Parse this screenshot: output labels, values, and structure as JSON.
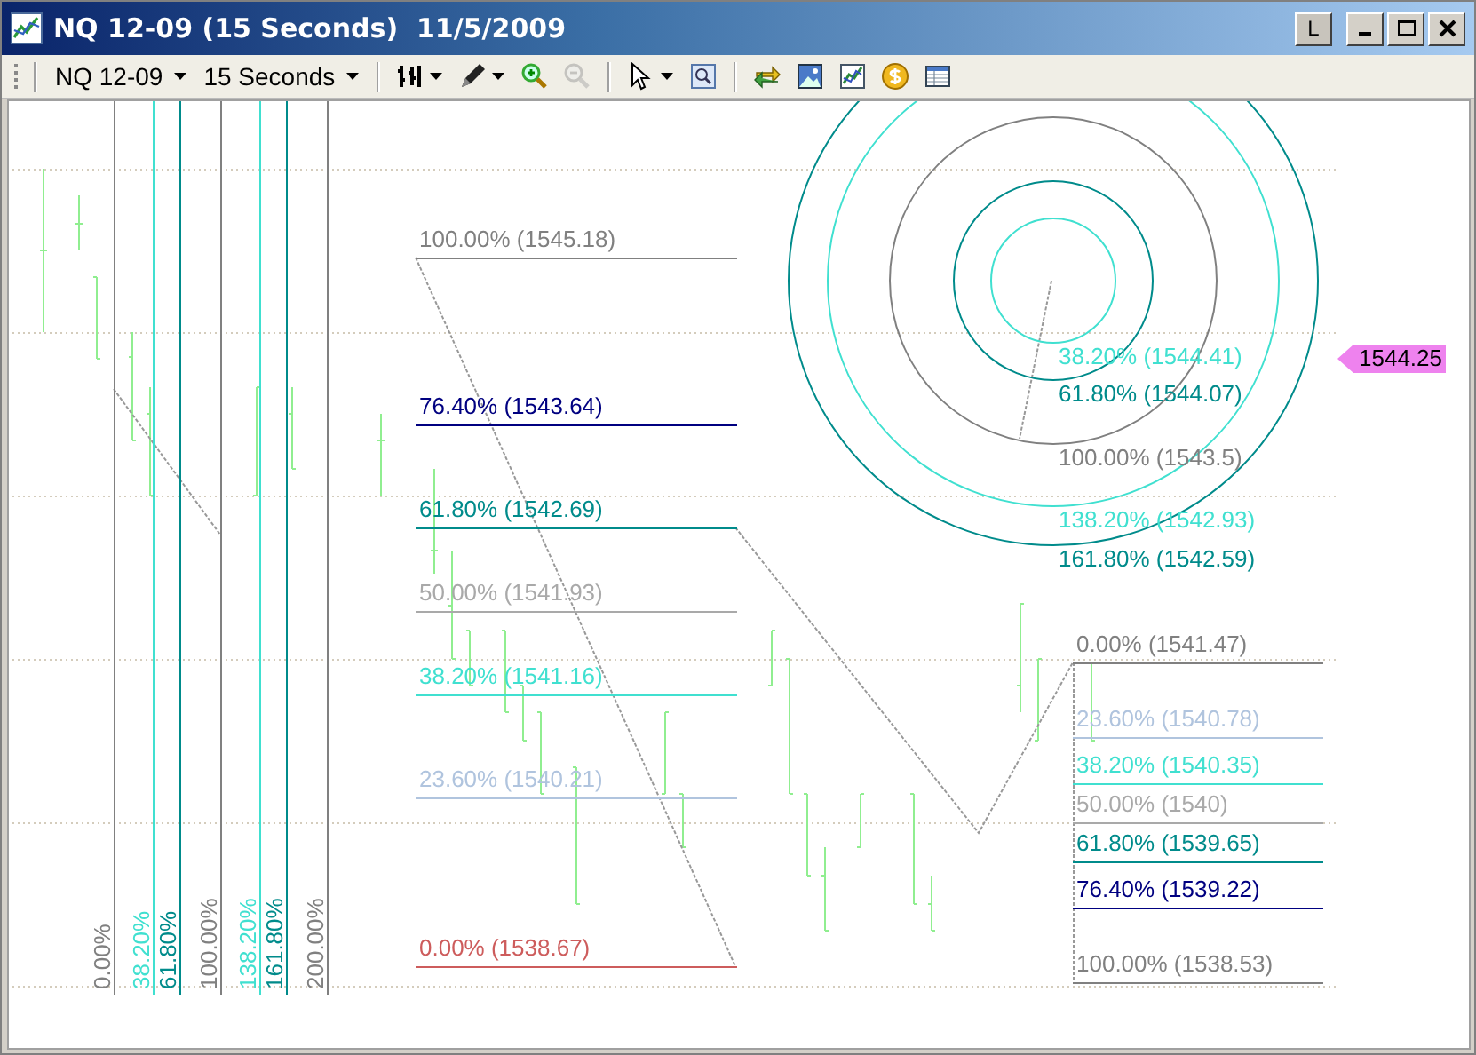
{
  "window": {
    "title": "NQ 12-09 (15 Seconds)  11/5/2009",
    "title_buttons": [
      {
        "kind": "text",
        "label": "L"
      },
      {
        "kind": "minimize"
      },
      {
        "kind": "maximize"
      },
      {
        "kind": "close"
      }
    ]
  },
  "toolbar": {
    "instrument": "NQ 12-09",
    "interval": "15 Seconds",
    "zoom_out_disabled": true
  },
  "price_marker": {
    "text": "1544.25",
    "color": "#ee82ee"
  },
  "fib_time_extensions": [
    {
      "label": "0.00%",
      "color": "#808080"
    },
    {
      "label": "38.20%",
      "color": "#40e0d0"
    },
    {
      "label": "61.80%",
      "color": "#008b8b"
    },
    {
      "label": "100.00%",
      "color": "#808080"
    },
    {
      "label": "138.20%",
      "color": "#40e0d0"
    },
    {
      "label": "161.80%",
      "color": "#008b8b"
    },
    {
      "label": "200.00%",
      "color": "#808080"
    }
  ],
  "fib_retracements": [
    {
      "label": "100.00% (1545.18)",
      "color": "#808080"
    },
    {
      "label": "76.40% (1543.64)",
      "color": "#000080"
    },
    {
      "label": "61.80% (1542.69)",
      "color": "#008b8b"
    },
    {
      "label": "50.00% (1541.93)",
      "color": "#a9a9a9"
    },
    {
      "label": "38.20% (1541.16)",
      "color": "#40e0d0"
    },
    {
      "label": "23.60% (1540.21)",
      "color": "#b0c4de"
    },
    {
      "label": "0.00% (1538.67)",
      "color": "#cd5c5c"
    }
  ],
  "fib_circles": [
    {
      "label": "38.20% (1544.41)",
      "color": "#40e0d0"
    },
    {
      "label": "61.80% (1544.07)",
      "color": "#008b8b"
    },
    {
      "label": "100.00% (1543.5)",
      "color": "#808080"
    },
    {
      "label": "138.20% (1542.93)",
      "color": "#40e0d0"
    },
    {
      "label": "161.80% (1542.59)",
      "color": "#008b8b"
    }
  ],
  "fib_extensions": [
    {
      "label": "0.00% (1541.47)",
      "color": "#808080"
    },
    {
      "label": "23.60% (1540.78)",
      "color": "#b0c4de"
    },
    {
      "label": "38.20% (1540.35)",
      "color": "#40e0d0"
    },
    {
      "label": "50.00% (1540)",
      "color": "#a9a9a9"
    },
    {
      "label": "61.80% (1539.65)",
      "color": "#008b8b"
    },
    {
      "label": "76.40% (1539.22)",
      "color": "#000080"
    },
    {
      "label": "100.00% (1538.53)",
      "color": "#808080"
    }
  ]
}
